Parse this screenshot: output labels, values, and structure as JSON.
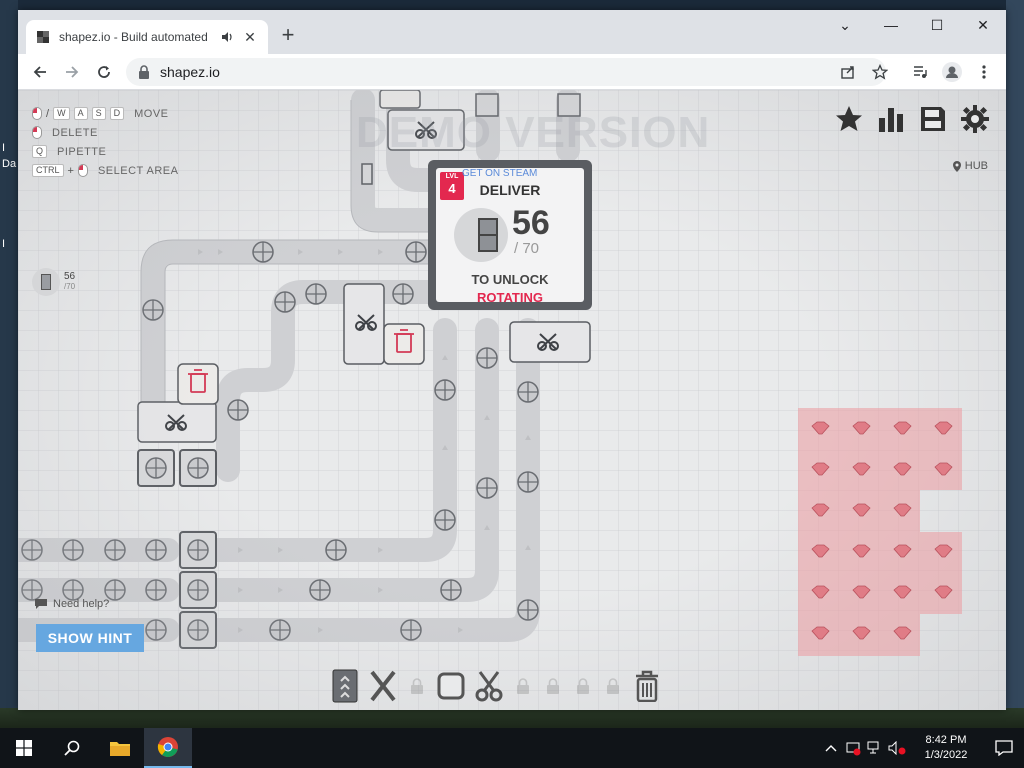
{
  "desktop": {
    "stray_labels": [
      "I",
      "Da",
      "I"
    ]
  },
  "browser": {
    "tab": {
      "title": "shapez.io - Build automated"
    },
    "address": "shapez.io"
  },
  "game": {
    "watermark": "DEMO VERSION",
    "keybindings": [
      {
        "keys": [
          "/",
          "W",
          "A",
          "S",
          "D"
        ],
        "label": "MOVE"
      },
      {
        "keys": [],
        "label": "DELETE"
      },
      {
        "keys": [
          "Q"
        ],
        "label": "PIPETTE"
      },
      {
        "keys": [
          "CTRL",
          "+"
        ],
        "label": "SELECT AREA"
      }
    ],
    "hub_label": "HUB",
    "mini_level": {
      "count": "56",
      "required": "/70"
    },
    "hub": {
      "level_tag": "LVL",
      "level": "4",
      "steam_link": "GET ON STEAM",
      "deliver": "DELIVER",
      "delivered": "56",
      "required": "/ 70",
      "to_unlock": "TO UNLOCK",
      "reward": "ROTATING"
    },
    "help_text": "Need help?",
    "hint_button": "SHOW HINT",
    "buildings": [
      "belt",
      "balancer",
      "locked",
      "rotator",
      "cutter",
      "locked",
      "locked",
      "locked",
      "locked",
      "trash"
    ],
    "colors": {
      "accent": "#e3284f",
      "hint": "#66a7e0",
      "ore": "#e07c86"
    }
  },
  "taskbar": {
    "time": "8:42 PM",
    "date": "1/3/2022"
  }
}
